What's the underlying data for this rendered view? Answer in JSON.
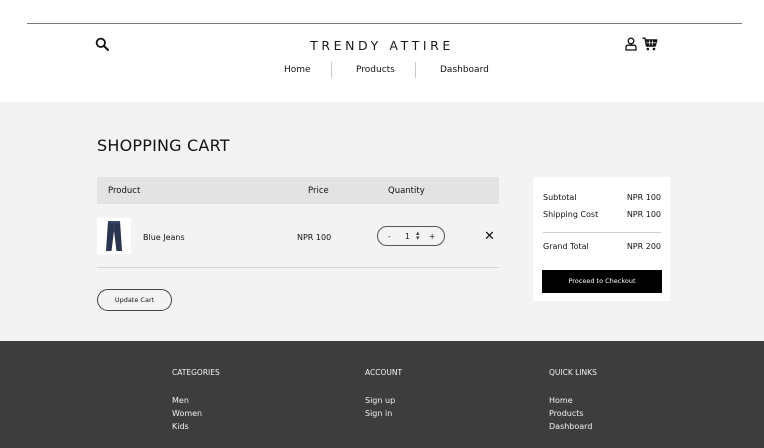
{
  "header": {
    "brand": "TRENDY ATTIRE",
    "icons": {
      "search": "search-icon",
      "user": "user-icon",
      "cart": "cart-icon"
    },
    "nav": [
      "Home",
      "Products",
      "Dashboard"
    ]
  },
  "cart": {
    "title": "SHOPPING CART",
    "columns": {
      "product": "Product",
      "price": "Price",
      "quantity": "Quantity"
    },
    "items": [
      {
        "name": "Blue Jeans",
        "price": "NPR 100",
        "quantity": "1",
        "minus": "-",
        "plus": "+",
        "remove": "✕"
      }
    ],
    "update_label": "Update Cart"
  },
  "summary": {
    "subtotal_label": "Subtotal",
    "subtotal_value": "NPR 100",
    "shipping_label": "Shipping Cost",
    "shipping_value": "NPR 100",
    "total_label": "Grand Total",
    "total_value": "NPR 200",
    "checkout_label": "Proceed to Checkout"
  },
  "footer": {
    "categories": {
      "title": "CATEGORIES",
      "links": [
        "Men",
        "Women",
        "Kids"
      ]
    },
    "account": {
      "title": "ACCOUNT",
      "links": [
        "Sign up",
        "Sign in"
      ]
    },
    "quick_links": {
      "title": "QUICK LINKS",
      "links": [
        "Home",
        "Products",
        "Dashboard"
      ]
    }
  },
  "colors": {
    "main_bg": "#f3f3f3",
    "footer_bg": "#3d3d3d",
    "table_head_bg": "#e3e3e3",
    "button_dark": "#000000"
  }
}
